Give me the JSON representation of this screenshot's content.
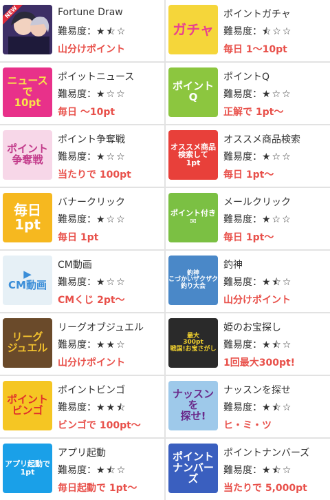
{
  "difficulty_label": "難易度：",
  "items": [
    {
      "name": "Fortune Draw",
      "stars": "★⯪☆",
      "reward": "山分けポイント",
      "icon": {
        "kind": "portrait",
        "badge": "NEW",
        "bg": "#5a4a8a"
      }
    },
    {
      "name": "ポイントガチャ",
      "stars": "⯪☆☆",
      "reward": "毎日 1〜10pt",
      "icon": {
        "kind": "text",
        "text": "ガチャ",
        "bg": "#f5d63a",
        "fg": "#e8418f"
      }
    },
    {
      "name": "ポイットニュース",
      "stars": "★☆☆",
      "reward": "毎日 〜10pt",
      "icon": {
        "kind": "text",
        "text": "ニュースで\n10pt",
        "bg": "#e8318a",
        "fg": "#f9e24a"
      }
    },
    {
      "name": "ポイントQ",
      "stars": "★☆☆",
      "reward": "正解で 1pt〜",
      "icon": {
        "kind": "text",
        "text": "ポイント\nQ",
        "bg": "#8cc63f",
        "fg": "#ffffff"
      }
    },
    {
      "name": "ポイント争奪戦",
      "stars": "★☆☆",
      "reward": "当たりで 100pt",
      "icon": {
        "kind": "text",
        "text": "ポイント\n争奪戦",
        "bg": "#f7d7e8",
        "fg": "#c23a8a"
      }
    },
    {
      "name": "オススメ商品検索",
      "stars": "★☆☆",
      "reward": "毎日 1pt〜",
      "icon": {
        "kind": "text",
        "text": "オススメ商品\n検索して\n1pt",
        "bg": "#e8403a",
        "fg": "#ffffff"
      }
    },
    {
      "name": "バナークリック",
      "stars": "★☆☆",
      "reward": "毎日 1pt",
      "icon": {
        "kind": "text",
        "text": "毎日\n1pt",
        "bg": "#f6b81f",
        "fg": "#ffffff"
      }
    },
    {
      "name": "メールクリック",
      "stars": "★☆☆",
      "reward": "毎日 1pt〜",
      "icon": {
        "kind": "text",
        "text": "ポイント付き\n✉",
        "bg": "#7bc043",
        "fg": "#ffffff"
      }
    },
    {
      "name": "CM動画",
      "stars": "★☆☆",
      "reward": "CMくじ 2pt〜",
      "icon": {
        "kind": "text",
        "text": "▶\nCM動画",
        "bg": "#e6f0f6",
        "fg": "#3b8ed8"
      }
    },
    {
      "name": "釣神",
      "stars": "★⯪☆",
      "reward": "山分けポイント",
      "icon": {
        "kind": "text",
        "text": "釣神\nこづかいザクザク\n釣り大会",
        "bg": "#4a88c8",
        "fg": "#ffffff"
      }
    },
    {
      "name": "リーグオブジュエル",
      "stars": "★★☆",
      "reward": "山分けポイント",
      "icon": {
        "kind": "text",
        "text": "リーグ\nジュエル",
        "bg": "#6a4a2a",
        "fg": "#f2c12e"
      }
    },
    {
      "name": "姫のお宝探し",
      "stars": "★⯪☆",
      "reward": "1回最大300pt!",
      "icon": {
        "kind": "text",
        "text": "最大\n300pt\n戦国!お宝さがし",
        "bg": "#2a2a2a",
        "fg": "#f2d22e"
      }
    },
    {
      "name": "ポイントビンゴ",
      "stars": "★★⯪",
      "reward": "ビンゴで 100pt〜",
      "icon": {
        "kind": "text",
        "text": "ポイント\nビンゴ",
        "bg": "#f5c623",
        "fg": "#e0312a"
      }
    },
    {
      "name": "ナッスンを探せ",
      "stars": "★⯪☆",
      "reward": "ヒ・ミ・ツ",
      "icon": {
        "kind": "text",
        "text": "ナッスンを\n探せ!",
        "bg": "#9ec9ea",
        "fg": "#6a2a8a"
      }
    },
    {
      "name": "アプリ起動",
      "stars": "★⯪☆",
      "reward": "毎日起動で 1pt〜",
      "icon": {
        "kind": "text",
        "text": "アプリ起動で\n1pt",
        "bg": "#1aa0e8",
        "fg": "#ffffff"
      }
    },
    {
      "name": "ポイントナンバーズ",
      "stars": "★⯪☆",
      "reward": "当たりで 5,000pt",
      "icon": {
        "kind": "text",
        "text": "ポイント\nナンバーズ",
        "bg": "#3a5fbf",
        "fg": "#ffffff"
      }
    }
  ]
}
